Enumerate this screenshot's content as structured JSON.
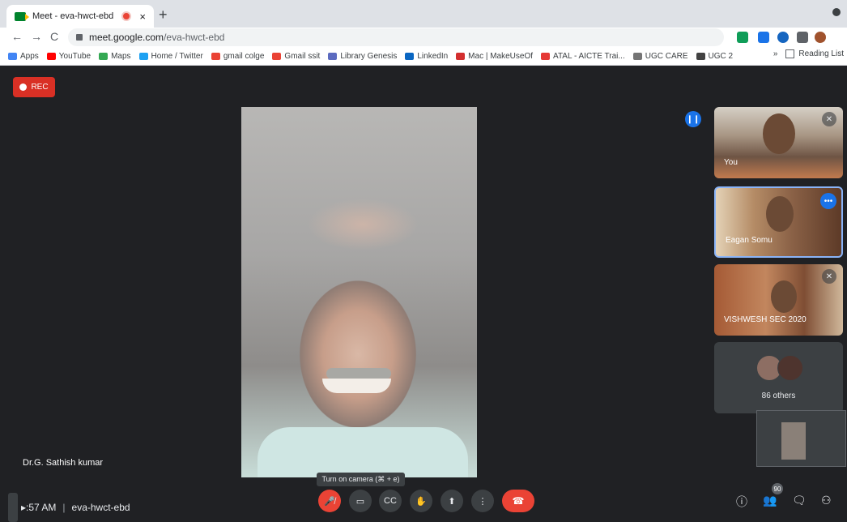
{
  "browser": {
    "tab_title": "Meet - eva-hwct-ebd",
    "tab_close": "×",
    "new_tab": "+",
    "url_domain": "meet.google.com",
    "url_path": "/eva-hwct-ebd",
    "nav_back": "←",
    "nav_forward": "→",
    "nav_reload": "C"
  },
  "bookmarks": {
    "items": [
      {
        "label": "Apps",
        "color": "#4285f4"
      },
      {
        "label": "YouTube",
        "color": "#ff0000"
      },
      {
        "label": "Maps",
        "color": "#34a853"
      },
      {
        "label": "Home / Twitter",
        "color": "#1da1f2"
      },
      {
        "label": "gmail colge",
        "color": "#ea4335"
      },
      {
        "label": "Gmail ssit",
        "color": "#ea4335"
      },
      {
        "label": "Library Genesis",
        "color": "#5c6bc0"
      },
      {
        "label": "LinkedIn",
        "color": "#0a66c2"
      },
      {
        "label": "Mac | MakeUseOf",
        "color": "#d32f2f"
      },
      {
        "label": "ATAL - AICTE Trai...",
        "color": "#e53935"
      },
      {
        "label": "UGC CARE",
        "color": "#757575"
      },
      {
        "label": "UGC 2",
        "color": "#424242"
      }
    ],
    "more": "»",
    "reading_list": "Reading List"
  },
  "meet": {
    "rec_label": "REC",
    "main_speaker": "Dr.G. Sathish kumar",
    "tiles": [
      {
        "name": "You"
      },
      {
        "name": "Eagan Somu"
      },
      {
        "name": "VISHWESH SEC 2020"
      }
    ],
    "others_label": "86 others",
    "tooltip": "Turn on camera (⌘ + e)",
    "time": "▸:57 AM",
    "meeting_code": "eva-hwct-ebd",
    "participant_count": "90",
    "controls": {
      "mic": "🎤̸",
      "camera": "▭",
      "captions": "CC",
      "hand": "✋",
      "present": "⬆",
      "more": "⋮",
      "end": "☎"
    },
    "right_icons": {
      "info": "ⓘ",
      "people": "👥",
      "chat": "🗨",
      "activities": "⚇"
    }
  }
}
